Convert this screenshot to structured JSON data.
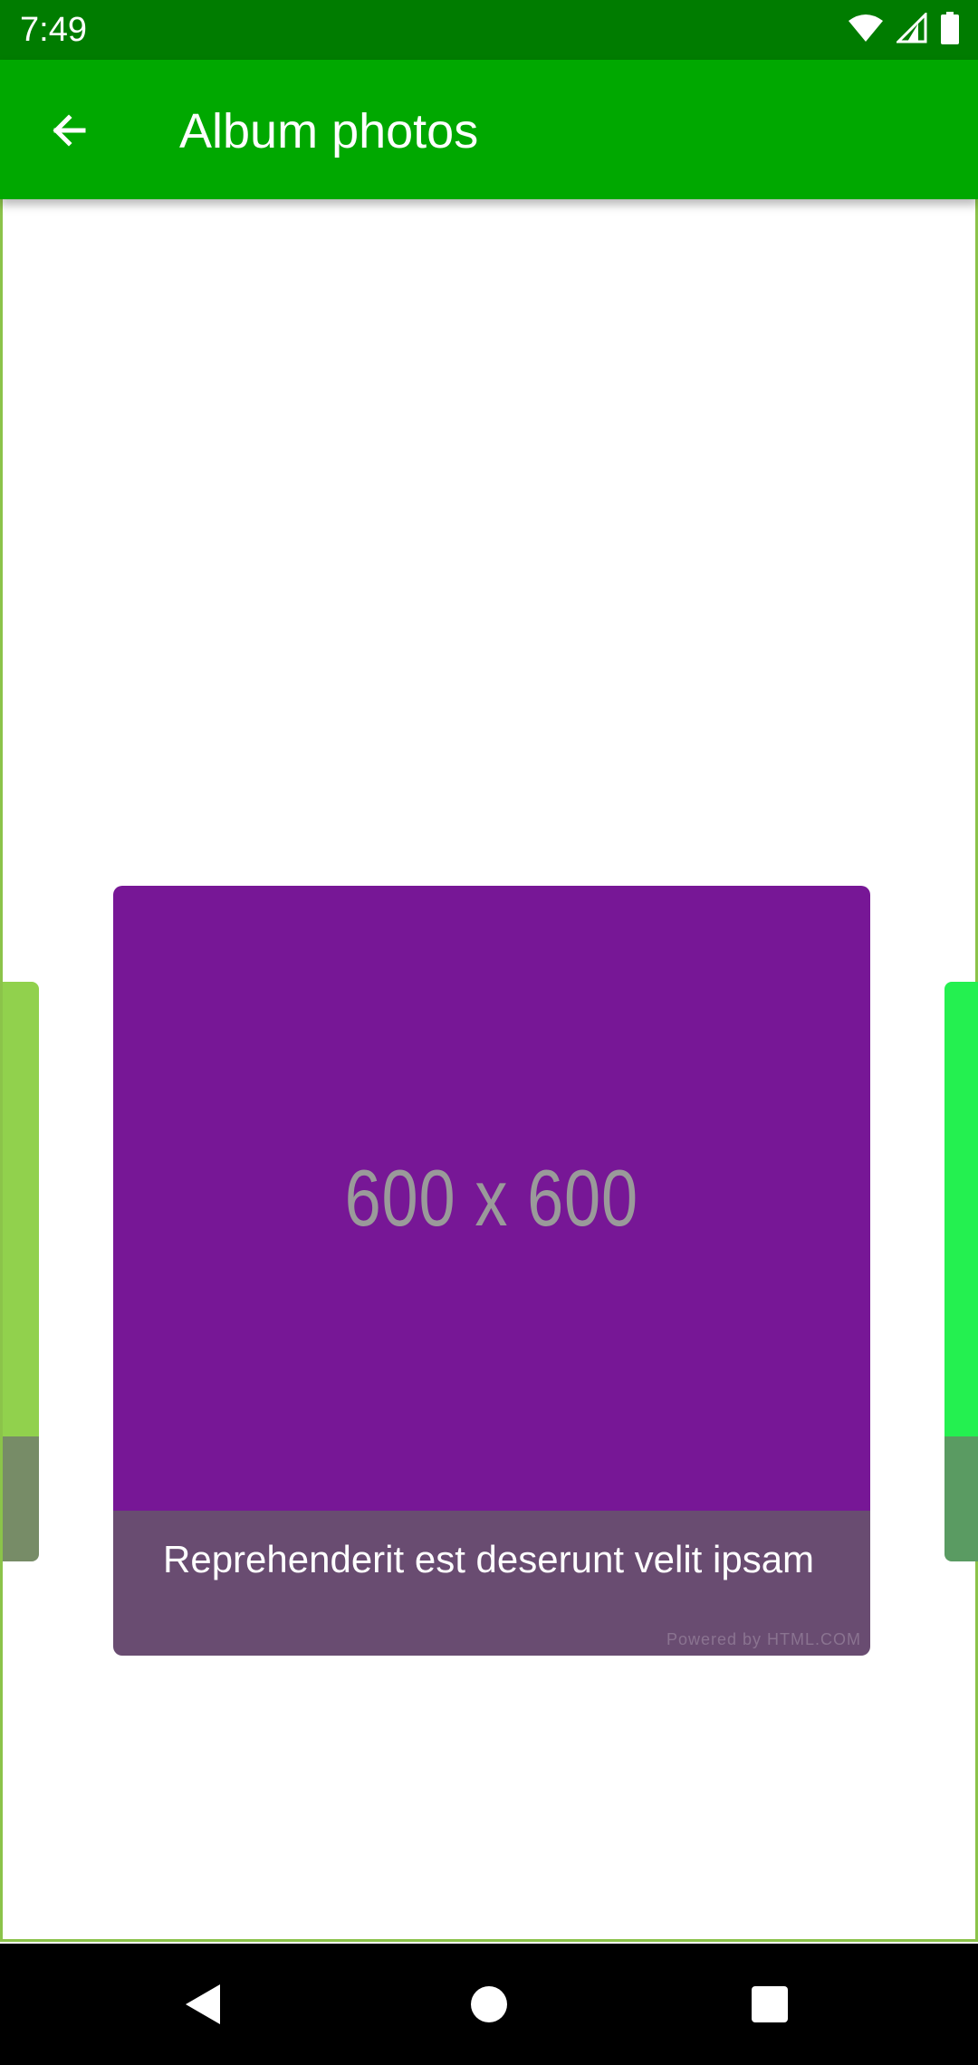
{
  "status_bar": {
    "time": "7:49",
    "icons": [
      "wifi-icon",
      "signal-icon",
      "battery-icon"
    ],
    "background": "#007c00"
  },
  "app_bar": {
    "title": "Album photos",
    "back_icon": "arrow-back-icon",
    "background": "#00a800"
  },
  "carousel": {
    "current": {
      "image_label": "600 x 600",
      "image_color": "#771796",
      "caption": "Reprehenderit est deserunt velit ipsam",
      "caption_background": "#694c71",
      "watermark": "Powered by HTML.COM"
    },
    "previous": {
      "image_color": "#91d14d",
      "caption_background": "#778c67"
    },
    "next": {
      "image_color": "#24f050",
      "caption_background": "#5a9b62"
    }
  },
  "navigation_bar": {
    "buttons": [
      "back-triangle-icon",
      "home-circle-icon",
      "recents-square-icon"
    ]
  }
}
